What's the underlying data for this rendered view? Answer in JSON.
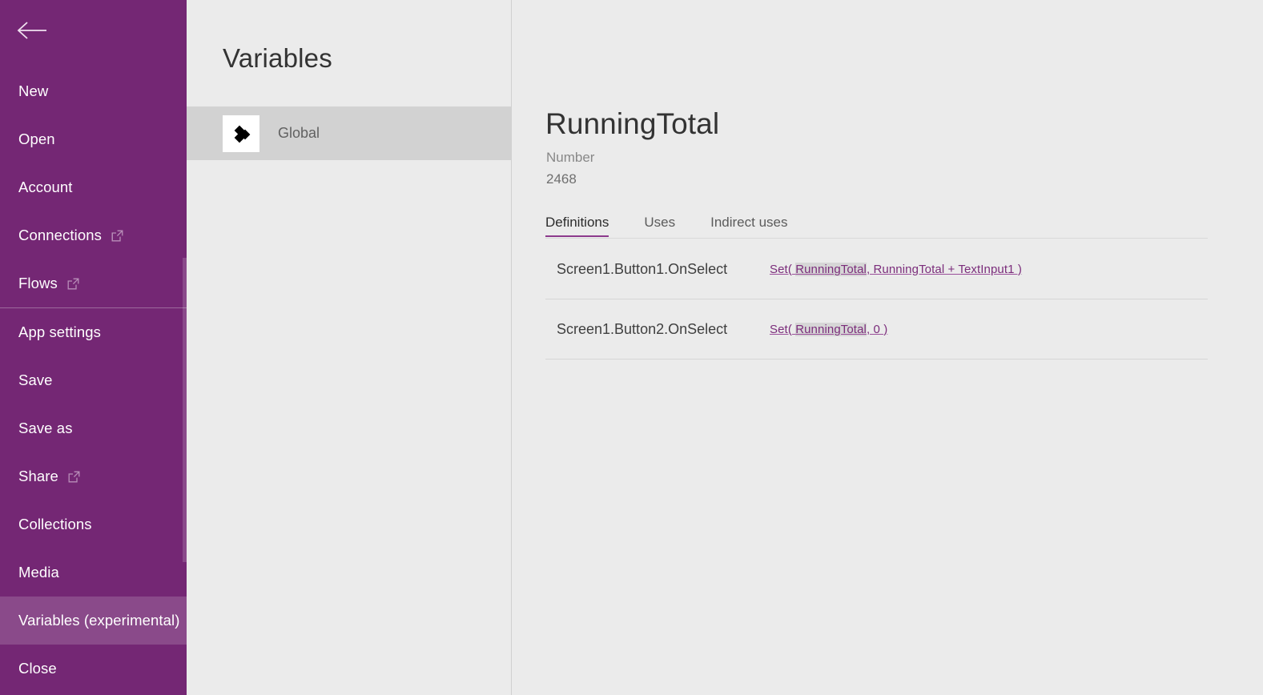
{
  "nav": {
    "back_icon": "back-arrow-icon",
    "groups": [
      {
        "items": [
          {
            "label": "New",
            "external": false
          },
          {
            "label": "Open",
            "external": false
          },
          {
            "label": "Account",
            "external": false
          },
          {
            "label": "Connections",
            "external": true
          },
          {
            "label": "Flows",
            "external": true
          }
        ]
      },
      {
        "items": [
          {
            "label": "App settings",
            "external": false
          },
          {
            "label": "Save",
            "external": false
          },
          {
            "label": "Save as",
            "external": false
          },
          {
            "label": "Share",
            "external": true
          },
          {
            "label": "Collections",
            "external": false
          },
          {
            "label": "Media",
            "external": false
          },
          {
            "label": "Variables (experimental)",
            "external": false,
            "selected": true
          },
          {
            "label": "Close",
            "external": false
          }
        ]
      }
    ]
  },
  "list_panel": {
    "title": "Variables",
    "items": [
      {
        "label": "Global",
        "icon": "diamonds-icon",
        "selected": true
      }
    ]
  },
  "detail": {
    "title": "RunningTotal",
    "type": "Number",
    "value": "2468",
    "tabs": [
      {
        "label": "Definitions",
        "active": true
      },
      {
        "label": "Uses",
        "active": false
      },
      {
        "label": "Indirect uses",
        "active": false
      }
    ],
    "definitions": [
      {
        "source": "Screen1.Button1.OnSelect",
        "formula_prefix": "Set( ",
        "formula_highlight": "RunningTotal",
        "formula_suffix": ", RunningTotal + TextInput1 )"
      },
      {
        "source": "Screen1.Button2.OnSelect",
        "formula_prefix": "Set( ",
        "formula_highlight": "RunningTotal",
        "formula_suffix": ", 0 )"
      }
    ]
  },
  "colors": {
    "brand_purple": "#742774",
    "brand_purple_selected": "#8a4a8a",
    "accent_underline": "#8c3a8c",
    "link_purple": "#7b2d7b",
    "panel_bg": "#ebebeb",
    "selected_row": "#d2d2d2"
  }
}
